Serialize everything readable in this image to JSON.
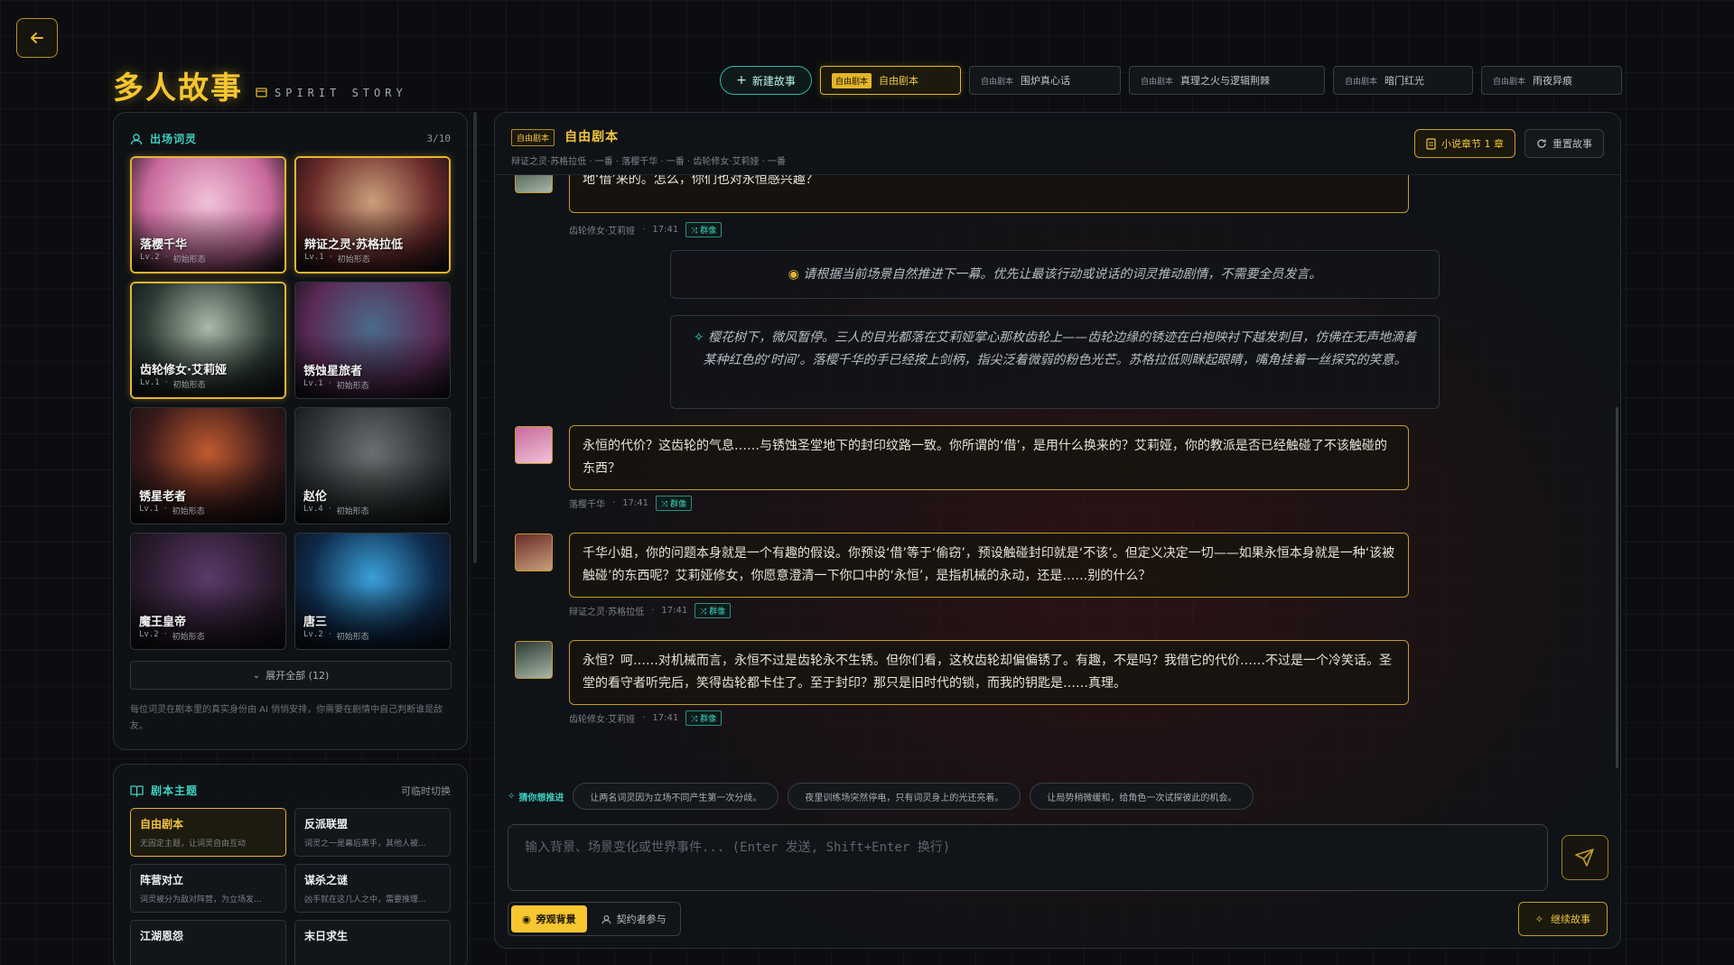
{
  "header": {
    "title": "多人故事",
    "subtitle": "SPIRIT STORY"
  },
  "topbar": {
    "new_story_label": "新建故事",
    "tabs": [
      {
        "tag": "自由剧本",
        "label": "自由剧本",
        "active": true
      },
      {
        "tag": "自由剧本",
        "label": "围炉真心话",
        "active": false
      },
      {
        "tag": "自由剧本",
        "label": "真理之火与逻辑荆棘",
        "active": false
      },
      {
        "tag": "自由剧本",
        "label": "暗门红光",
        "active": false
      },
      {
        "tag": "自由剧本",
        "label": "雨夜异痕",
        "active": false
      }
    ]
  },
  "cast": {
    "label": "出场词灵",
    "count": "3/10",
    "cards": [
      {
        "name": "落樱千华",
        "level": "Lv.2",
        "form": "初始形态",
        "selected": true,
        "colors": [
          "#c96a9c",
          "#f0c2d8"
        ]
      },
      {
        "name": "辩证之灵·苏格拉低",
        "level": "Lv.1",
        "form": "初始形态",
        "selected": true,
        "colors": [
          "#6a2a2a",
          "#caa07a"
        ]
      },
      {
        "name": "齿轮修女·艾莉娅",
        "level": "Lv.1",
        "form": "初始形态",
        "selected": true,
        "colors": [
          "#2c3a34",
          "#a9b8a8"
        ]
      },
      {
        "name": "锈蚀星旅者",
        "level": "Lv.1",
        "form": "初始形态",
        "selected": false,
        "colors": [
          "#5a2a55",
          "#4a6a8a"
        ]
      },
      {
        "name": "锈星老者",
        "level": "Lv.1",
        "form": "初始形态",
        "selected": false,
        "colors": [
          "#3a1a1a",
          "#c05a30"
        ]
      },
      {
        "name": "赵伦",
        "level": "Lv.4",
        "form": "初始形态",
        "selected": false,
        "colors": [
          "#2c3234",
          "#6a7070"
        ]
      },
      {
        "name": "魔王皇帝",
        "level": "Lv.2",
        "form": "初始形态",
        "selected": false,
        "colors": [
          "#2a1a2c",
          "#5a3a6a"
        ]
      },
      {
        "name": "唐三",
        "level": "Lv.2",
        "form": "初始形态",
        "selected": false,
        "colors": [
          "#0e2a4a",
          "#3aa0d8"
        ]
      }
    ],
    "expand_label": "展开全部 (12)",
    "note": "每位词灵在剧本里的真实身份由 AI 悄悄安排，你需要在剧情中自己判断谁是敌友。"
  },
  "themes": {
    "label": "剧本主题",
    "hint": "可临时切换",
    "items": [
      {
        "title": "自由剧本",
        "desc": "无固定主题，让词灵自由互动",
        "active": true
      },
      {
        "title": "反派联盟",
        "desc": "词灵之一是幕后黑手，其他人被...",
        "active": false
      },
      {
        "title": "阵营对立",
        "desc": "词灵被分为敌对阵营，为立场发...",
        "active": false
      },
      {
        "title": "谋杀之谜",
        "desc": "凶手就在这几人之中，需要推理...",
        "active": false
      },
      {
        "title": "江湖恩怨",
        "desc": "",
        "active": false
      },
      {
        "title": "末日求生",
        "desc": "",
        "active": false
      }
    ]
  },
  "story": {
    "tag": "自由剧本",
    "title": "自由剧本",
    "cast_line": "辩证之灵·苏格拉低 · 一番 · 落樱千华 · 一番 · 齿轮修女·艾莉娅 · 一番",
    "chapter_label": "小说章节 1 章",
    "reset_label": "重置故事",
    "group_badge": "群像",
    "messages": [
      {
        "text": "呵……阿恒真是百无知趣。这不过是一枚古老的齿轮，上面刻着‘永恒的代价’。我本想等‘锈蚀融消’时再展示的。既然你们问了——它是我从圣堂禁地‘借’来的。怎么，你们也对永恒感兴趣？",
        "speaker": "齿轮修女·艾莉娅",
        "time": "17:41"
      },
      {
        "text": "永恒的代价？这齿轮的气息……与锈蚀圣堂地下的封印纹路一致。你所谓的‘借’，是用什么换来的？艾莉娅，你的教派是否已经触碰了不该触碰的东西？",
        "speaker": "落樱千华",
        "time": "17:41"
      },
      {
        "text": "千华小姐，你的问题本身就是一个有趣的假设。你预设‘借’等于‘偷窃’，预设触碰封印就是‘不该’。但定义决定一切——如果永恒本身就是一种‘该被触碰’的东西呢？艾莉娅修女，你愿意澄清一下你口中的‘永恒’，是指机械的永动，还是……别的什么？",
        "speaker": "辩证之灵·苏格拉低",
        "time": "17:41"
      },
      {
        "text": "永恒？呵……对机械而言，永恒不过是齿轮永不生锈。但你们看，这枚齿轮却偏偏锈了。有趣，不是吗？我借它的代价……不过是一个冷笑话。圣堂的看守者听完后，笑得齿轮都卡住了。至于封印？那只是旧时代的锁，而我的钥匙是……真理。",
        "speaker": "齿轮修女·艾莉娅",
        "time": "17:41"
      }
    ],
    "system_prompt": "请根据当前场景自然推进下一幕。优先让最该行动或说话的词灵推动剧情，不需要全员发言。",
    "narration": "樱花树下，微风暂停。三人的目光都落在艾莉娅掌心那枚齿轮上——齿轮边缘的锈迹在白袍映衬下越发刺目，仿佛在无声地滴着某种红色的‘时间’。落樱千华的手已经按上剑柄，指尖泛着微弱的粉色光芒。苏格拉低则眯起眼睛，嘴角挂着一丝探究的笑意。"
  },
  "composer": {
    "guess_label": "猜你想推进",
    "suggestions": [
      "让两名词灵因为立场不同产生第一次分歧。",
      "夜里训练场突然停电，只有词灵身上的光还亮着。",
      "让局势稍微缓和，给角色一次试探彼此的机会。"
    ],
    "placeholder": "输入背景、场景变化或世界事件... (Enter 发送, Shift+Enter 换行)",
    "mode_observer": "旁观背景",
    "mode_player": "契约者参与",
    "continue_label": "继续故事"
  },
  "colors": {
    "accent_gold": "#f2c53d",
    "accent_teal": "#3fd0c0",
    "background": "#0b0d10"
  }
}
